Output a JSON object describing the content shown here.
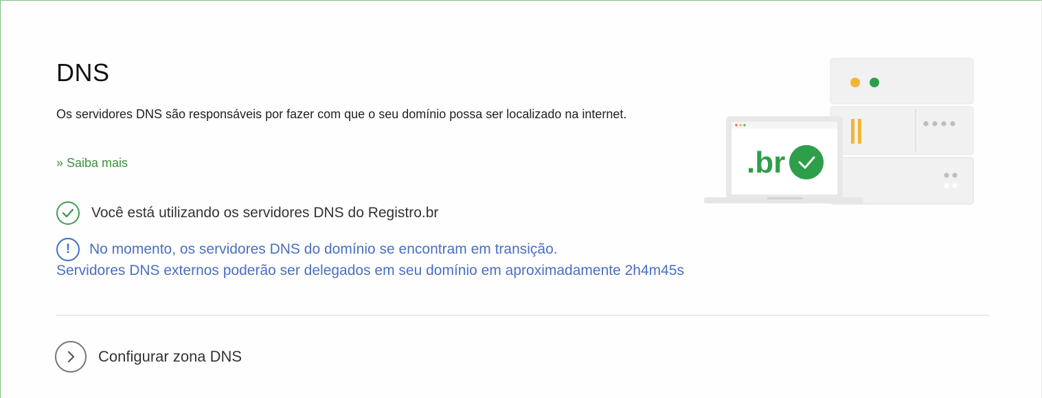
{
  "section": {
    "title": "DNS",
    "description": "Os servidores DNS são responsáveis por fazer com que o seu domínio possa ser localizado na internet.",
    "learn_more": "» Saiba mais"
  },
  "status": {
    "using_registro": "Você está utilizando os servidores DNS do Registro.br",
    "transition_line1": "No momento, os servidores DNS do domínio se encontram em transição.",
    "transition_line2": "Servidores DNS externos poderão ser delegados em seu domínio em aproximadamente 2h4m45s",
    "info_icon_glyph": "!"
  },
  "actions": {
    "configure_zone": "Configurar zona DNS"
  },
  "illustration": {
    "screen_label": ".br"
  },
  "colors": {
    "brand_green": "#2e9e4a",
    "info_blue": "#4a6fc1",
    "link_green": "#3f8f3f"
  },
  "icons": {
    "status_ok": "check-circle-icon",
    "status_info": "info-circle-icon",
    "configure": "chevron-right-circle-icon"
  }
}
